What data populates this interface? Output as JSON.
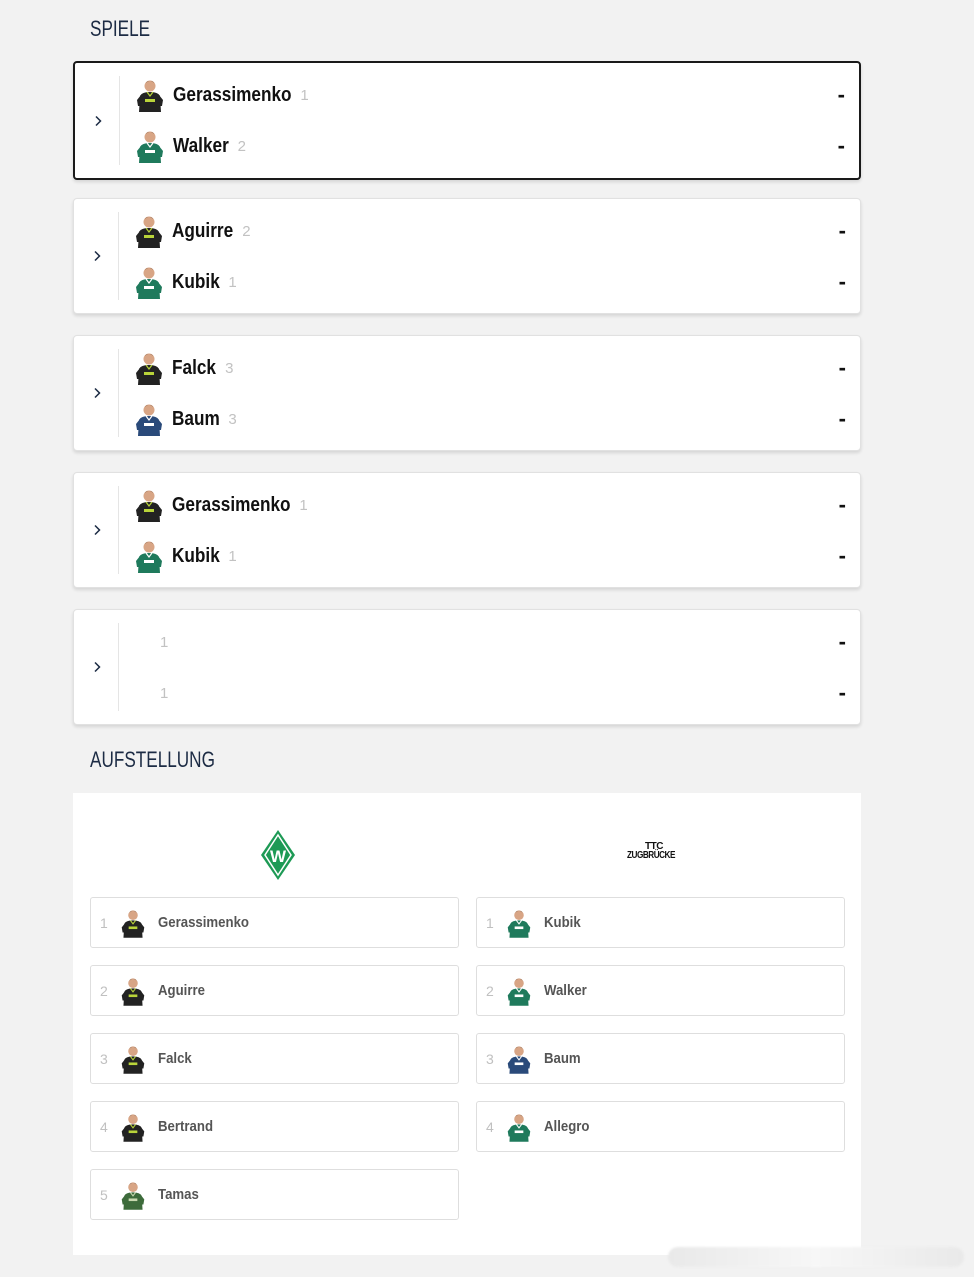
{
  "spiele": {
    "title": "SPIELE",
    "matches": [
      {
        "active": true,
        "home": {
          "name": "Gerassimenko",
          "rank": "1",
          "kit": "dark",
          "score": "-"
        },
        "away": {
          "name": "Walker",
          "rank": "2",
          "kit": "green",
          "score": "-"
        }
      },
      {
        "active": false,
        "home": {
          "name": "Aguirre",
          "rank": "2",
          "kit": "dark",
          "score": "-"
        },
        "away": {
          "name": "Kubik",
          "rank": "1",
          "kit": "green",
          "score": "-"
        }
      },
      {
        "active": false,
        "home": {
          "name": "Falck",
          "rank": "3",
          "kit": "dark",
          "score": "-"
        },
        "away": {
          "name": "Baum",
          "rank": "3",
          "kit": "blue",
          "score": "-"
        }
      },
      {
        "active": false,
        "home": {
          "name": "Gerassimenko",
          "rank": "1",
          "kit": "dark",
          "score": "-"
        },
        "away": {
          "name": "Kubik",
          "rank": "1",
          "kit": "green",
          "score": "-"
        }
      },
      {
        "active": false,
        "home": {
          "name": "",
          "rank": "1",
          "kit": "",
          "score": "-"
        },
        "away": {
          "name": "",
          "rank": "1",
          "kit": "",
          "score": "-"
        }
      }
    ]
  },
  "aufstellung": {
    "title": "AUFSTELLUNG",
    "home_logo": "werder-bremen-diamond-logo",
    "away_logo": {
      "icon": "ttc-zugbruecke-logo",
      "text_top": "TTC",
      "text_main": "ZUGBRÜCKE"
    },
    "home": [
      {
        "num": "1",
        "name": "Gerassimenko",
        "kit": "dark"
      },
      {
        "num": "2",
        "name": "Aguirre",
        "kit": "dark"
      },
      {
        "num": "3",
        "name": "Falck",
        "kit": "dark"
      },
      {
        "num": "4",
        "name": "Bertrand",
        "kit": "dark"
      },
      {
        "num": "5",
        "name": "Tamas",
        "kit": "light"
      }
    ],
    "away": [
      {
        "num": "1",
        "name": "Kubik",
        "kit": "green"
      },
      {
        "num": "2",
        "name": "Walker",
        "kit": "green"
      },
      {
        "num": "3",
        "name": "Baum",
        "kit": "blue"
      },
      {
        "num": "4",
        "name": "Allegro",
        "kit": "green"
      }
    ]
  },
  "colors": {
    "heading": "#1c2b44",
    "green_kit": "#1f7a5c",
    "dark_kit": "#222222",
    "blue_kit": "#2a4a7a",
    "werder_green": "#1d9a55"
  }
}
